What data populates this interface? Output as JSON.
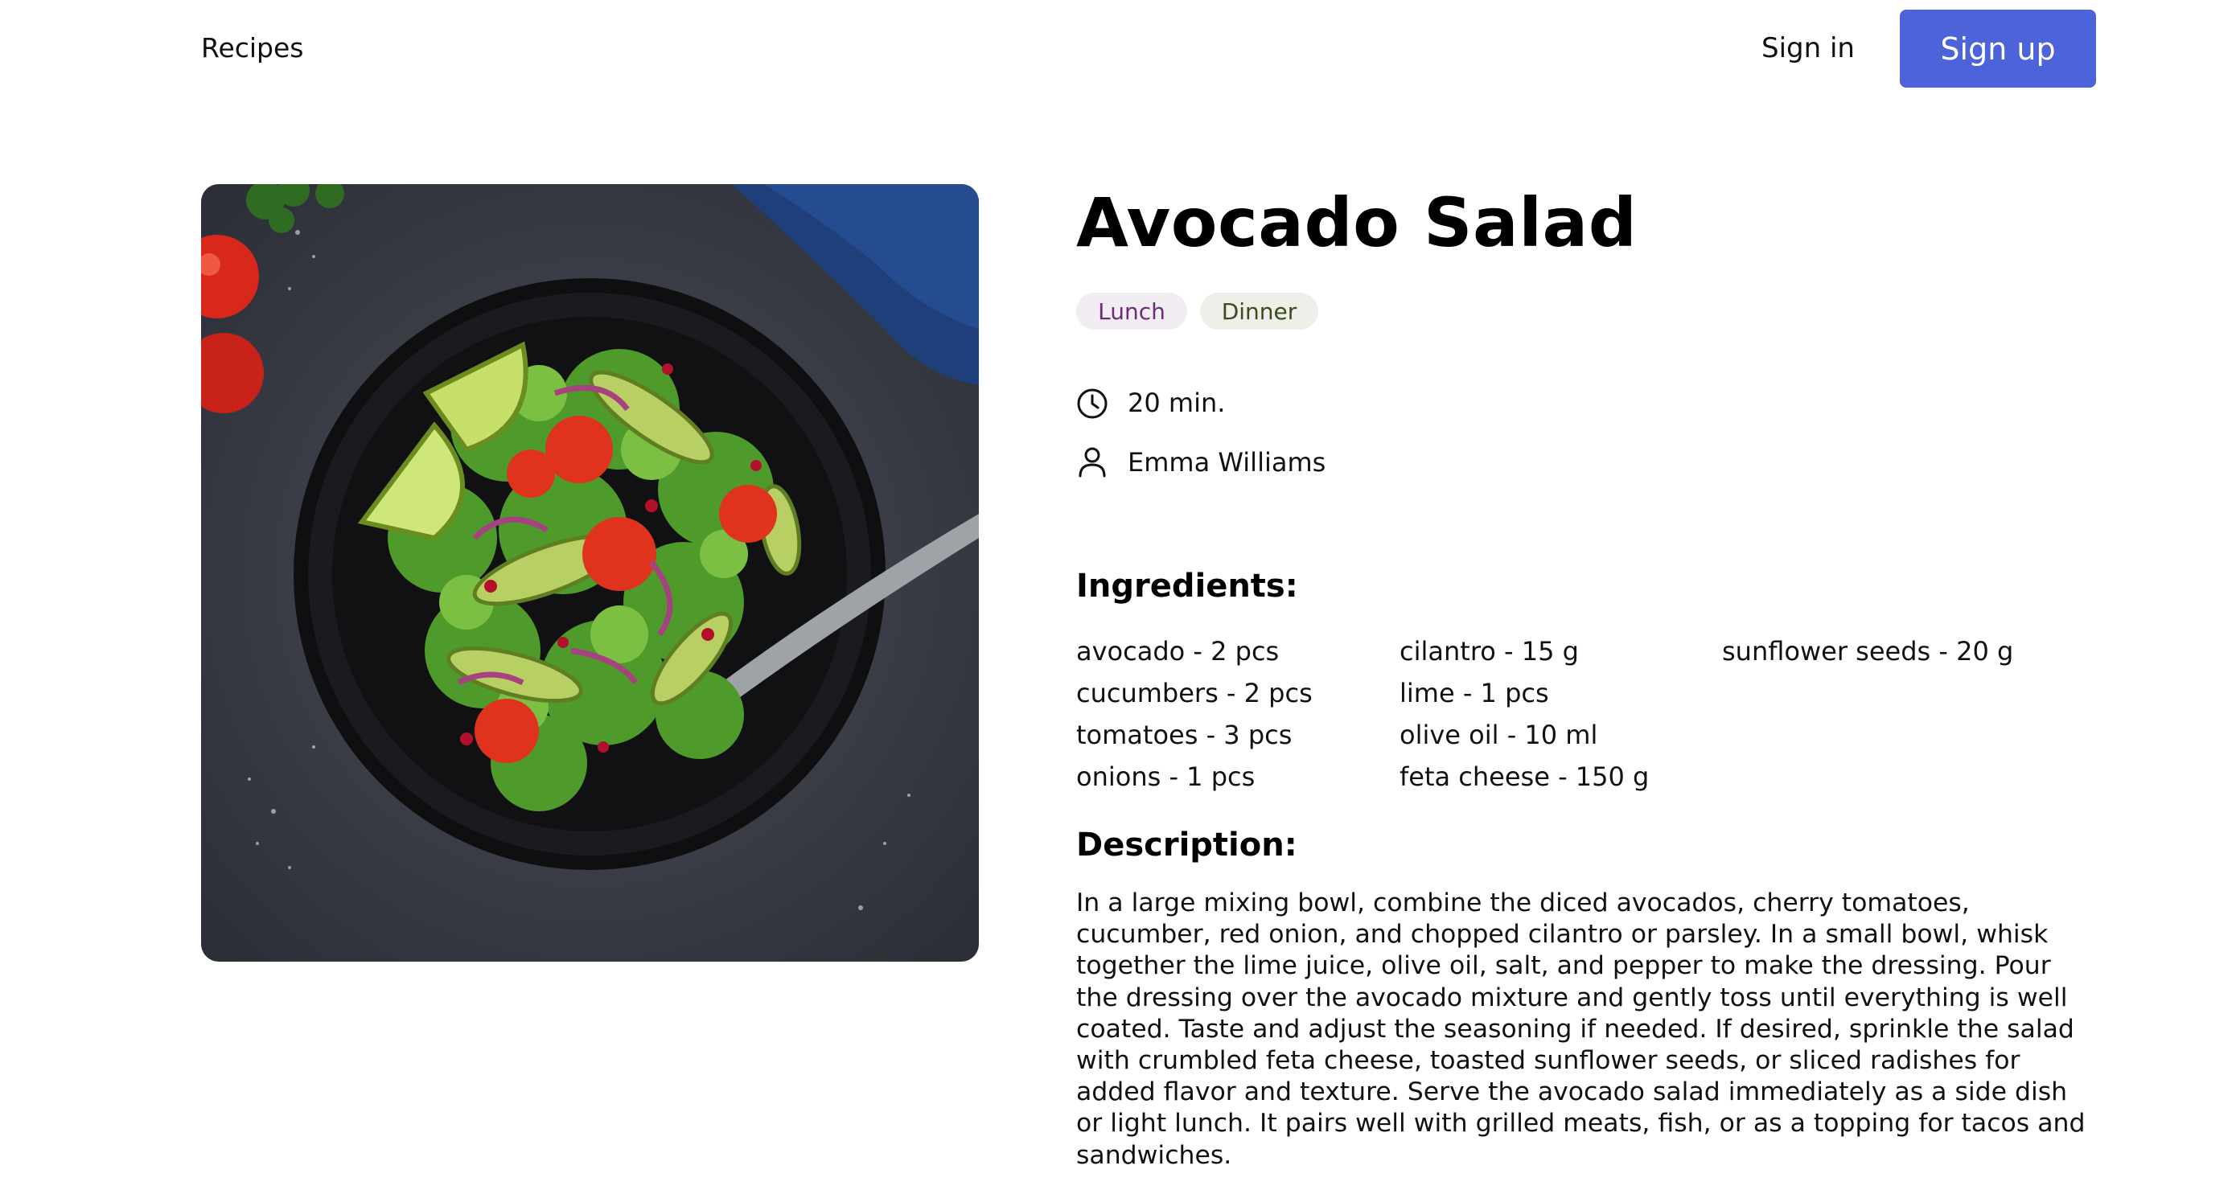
{
  "nav": {
    "brand": "Recipes",
    "sign_in": "Sign in",
    "sign_up": "Sign up",
    "sign_up_color": "#4c63d9"
  },
  "recipe": {
    "image_icon": "salad-bowl-photo",
    "title": "Avocado Salad",
    "tags": [
      {
        "label": "Lunch",
        "bg": "#f2ecf3",
        "fg": "#6a2e77"
      },
      {
        "label": "Dinner",
        "bg": "#edefe8",
        "fg": "#3c4a1e"
      }
    ],
    "time_icon": "clock-icon",
    "time": "20 min.",
    "author_icon": "user-icon",
    "author": "Emma Williams",
    "ingredients_title": "Ingredients:",
    "ingredients": [
      [
        "avocado - 2 pcs",
        "cucumbers - 2 pcs",
        "tomatoes - 3 pcs",
        "onions - 1 pcs"
      ],
      [
        "cilantro - 15 g",
        "lime - 1 pcs",
        "olive oil - 10 ml",
        "feta cheese - 150 g"
      ],
      [
        "sunflower seeds - 20 g"
      ]
    ],
    "description_title": "Description:",
    "description": "In a large mixing bowl, combine the diced avocados, cherry tomatoes, cucumber, red onion, and chopped cilantro or parsley. In a small bowl, whisk together the lime juice, olive oil, salt, and pepper to make the dressing. Pour the dressing over the avocado mixture and gently toss until everything is well coated. Taste and adjust the seasoning if needed. If desired, sprinkle the salad with crumbled feta cheese, toasted sunflower seeds, or sliced radishes for added flavor and texture. Serve the avocado salad immediately as a side dish or light lunch. It pairs well with grilled meats, fish, or as a topping for tacos and sandwiches."
  }
}
